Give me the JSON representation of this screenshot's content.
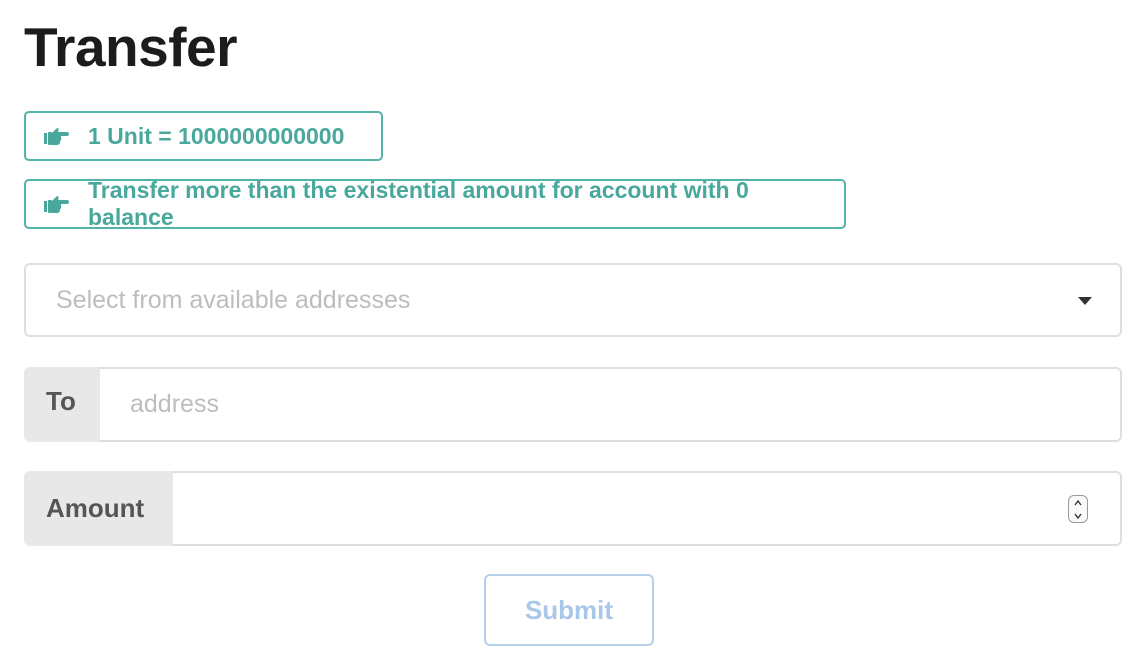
{
  "page": {
    "title": "Transfer"
  },
  "labels": {
    "unit_info": "1 Unit = 1000000000000",
    "existential_info": "Transfer more than the existential amount for account with 0 balance",
    "icon": "hand-pointing-right-icon"
  },
  "form": {
    "from_dropdown": {
      "placeholder": "Select from available addresses",
      "value": ""
    },
    "to": {
      "label": "To",
      "placeholder": "address",
      "value": ""
    },
    "amount": {
      "label": "Amount",
      "value": ""
    },
    "submit_label": "Submit"
  },
  "colors": {
    "accent": "#48a89b",
    "submit_disabled": "#a9c7e8",
    "addon_bg": "#e8e8e8"
  }
}
